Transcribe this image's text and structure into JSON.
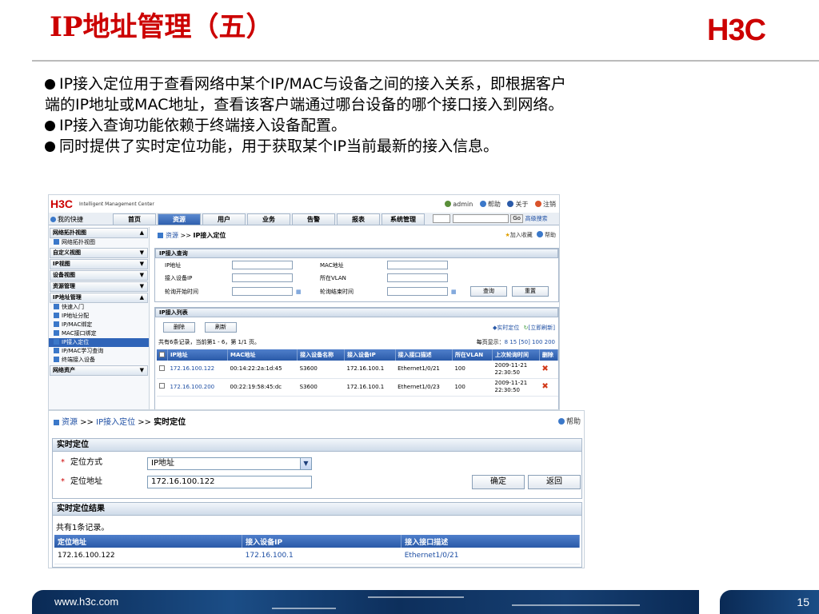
{
  "slide": {
    "title": "IP地址管理（五）",
    "logo": "H3C",
    "bullets": [
      "IP接入定位用于查看网络中某个IP/MAC与设备之间的接入关系，即根据客户",
      "端的IP地址或MAC地址，查看该客户端通过哪台设备的哪个接口接入到网络。",
      "IP接入查询功能依赖于终端接入设备配置。",
      "同时提供了实时定位功能，用于获取某个IP当前最新的接入信息。"
    ],
    "footer_url": "www.h3c.com",
    "page_number": "15"
  },
  "imc": {
    "logo": "H3C",
    "subtitle": "Intelligent Management Center",
    "user": "admin",
    "help": "帮助",
    "about": "关于",
    "logout": "注销",
    "favorites": "我的快捷",
    "tabs": [
      "首页",
      "资源",
      "用户",
      "业务",
      "告警",
      "报表",
      "系统管理"
    ],
    "active_tab": 1,
    "go": "Go",
    "advanced_search": "高级搜索",
    "sidebar": [
      {
        "type": "header",
        "label": "网络拓扑视图",
        "chev": "▲"
      },
      {
        "type": "item",
        "label": "网络拓扑视图"
      },
      {
        "type": "header",
        "label": "自定义视图",
        "chev": "▼"
      },
      {
        "type": "header",
        "label": "IP视图",
        "chev": "▼"
      },
      {
        "type": "header",
        "label": "设备视图",
        "chev": "▼"
      },
      {
        "type": "header",
        "label": "资源管理",
        "chev": "▼"
      },
      {
        "type": "header",
        "label": "IP地址管理",
        "chev": "▲"
      },
      {
        "type": "item",
        "label": "快速入门"
      },
      {
        "type": "item",
        "label": "IP地址分配"
      },
      {
        "type": "item",
        "label": "IP/MAC绑定"
      },
      {
        "type": "item",
        "label": "MAC接口绑定"
      },
      {
        "type": "item",
        "label": "IP接入定位",
        "active": true
      },
      {
        "type": "item",
        "label": "IP/MAC学习查询"
      },
      {
        "type": "item",
        "label": "终端接入设备"
      },
      {
        "type": "header",
        "label": "网络资产",
        "chev": "▼"
      }
    ],
    "breadcrumb": {
      "root": "资源",
      "sep": " >> ",
      "current": "IP接入定位"
    },
    "add_favorite": "加入收藏",
    "query": {
      "title": "IP接入查询",
      "ip_label": "IP地址",
      "mac_label": "MAC地址",
      "device_ip_label": "接入设备IP",
      "vlan_label": "所在VLAN",
      "start_label": "轮询开始时间",
      "end_label": "轮询结束时间",
      "query_btn": "查询",
      "reset_btn": "重置"
    },
    "list": {
      "title": "IP接入列表",
      "delete_btn": "删除",
      "refresh_btn": "刷新",
      "realtime_link": "实时定位",
      "refresh_now": "[立即刷新]",
      "summary": "共有6条记录，当前第1 - 6，第 1/1 页。",
      "page_size_label": "每页显示：",
      "page_sizes": "8 15 [50] 100 200",
      "columns": [
        "",
        "IP地址",
        "MAC地址",
        "接入设备名称",
        "接入设备IP",
        "接入接口描述",
        "所在VLAN",
        "上次轮询时间",
        "删除"
      ],
      "rows": [
        {
          "ip": "172.16.100.122",
          "mac": "00:14:22:2a:1d:45",
          "dev": "S3600",
          "dev_ip": "172.16.100.1",
          "iface": "Ethernet1/0/21",
          "vlan": "100",
          "time1": "2009-11-21",
          "time2": "22:30:50"
        },
        {
          "ip": "172.16.100.200",
          "mac": "00:22:19:58:45:dc",
          "dev": "S3600",
          "dev_ip": "172.16.100.1",
          "iface": "Ethernet1/0/23",
          "vlan": "100",
          "time1": "2009-11-21",
          "time2": "22:30:50"
        }
      ]
    }
  },
  "locate": {
    "breadcrumb": {
      "root": "资源",
      "mid": "IP接入定位",
      "current": "实时定位"
    },
    "help": "帮助",
    "panel_title": "实时定位",
    "method_label": "定位方式",
    "method_value": "IP地址",
    "address_label": "定位地址",
    "address_value": "172.16.100.122",
    "ok_btn": "确定",
    "back_btn": "返回",
    "result_title": "实时定位结果",
    "result_count": "共有1条记录。",
    "result_columns": [
      "定位地址",
      "接入设备IP",
      "接入接口描述"
    ],
    "result_rows": [
      {
        "addr": "172.16.100.122",
        "dev_ip": "172.16.100.1",
        "iface": "Ethernet1/0/21"
      }
    ]
  }
}
